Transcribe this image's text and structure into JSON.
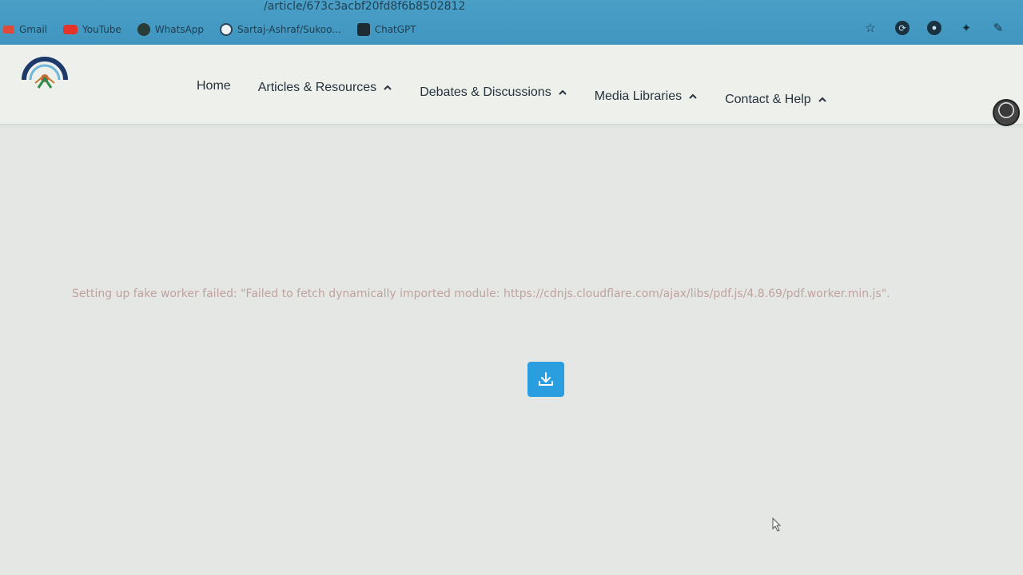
{
  "browser": {
    "url_fragment": "/article/673c3acbf20fd8f6b8502812",
    "bookmarks": [
      {
        "label": "Gmail",
        "icon": "gmail-icon"
      },
      {
        "label": "YouTube",
        "icon": "youtube-icon"
      },
      {
        "label": "WhatsApp",
        "icon": "whatsapp-icon"
      },
      {
        "label": "Sartaj-Ashraf/Sukoo...",
        "icon": "github-icon"
      },
      {
        "label": "ChatGPT",
        "icon": "chatgpt-icon"
      }
    ]
  },
  "nav": {
    "home": "Home",
    "articles": "Articles & Resources",
    "debates": "Debates & Discussions",
    "media": "Media Libraries",
    "contact": "Contact & Help"
  },
  "main": {
    "error_message": "Setting up fake worker failed: \"Failed to fetch dynamically imported module: https://cdnjs.cloudflare.com/ajax/libs/pdf.js/4.8.69/pdf.worker.min.js\"."
  },
  "colors": {
    "browser_bar": "#4a9fc7",
    "accent_button": "#2b9ee0",
    "error_text": "#c0a2a0"
  }
}
